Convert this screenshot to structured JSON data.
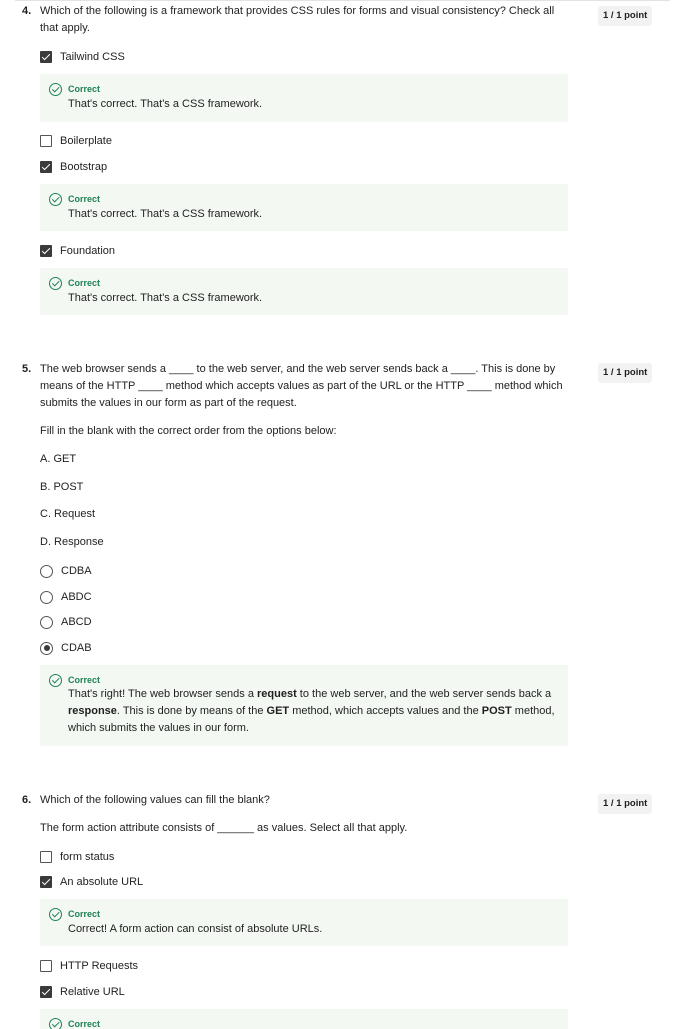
{
  "q4": {
    "number": "4.",
    "text": "Which of the following is a framework that provides CSS rules for forms and visual consistency? Check all that apply.",
    "points": "1 / 1 point",
    "options": [
      {
        "label": "Tailwind CSS",
        "checked": true
      },
      {
        "label": "Boilerplate",
        "checked": false
      },
      {
        "label": "Bootstrap",
        "checked": true
      },
      {
        "label": "Foundation",
        "checked": true
      }
    ],
    "feedback": [
      {
        "title": "Correct",
        "text": "That's correct. That's a CSS framework."
      },
      {
        "title": "Correct",
        "text": "That's correct. That's a CSS framework."
      },
      {
        "title": "Correct",
        "text": "That's correct. That's a CSS framework."
      }
    ]
  },
  "q5": {
    "number": "5.",
    "text": "The web browser sends a ____ to the web server, and the web server sends back a ____. This is done by means of the HTTP ____ method which accepts values as part of the URL or the HTTP ____ method which submits the values in our form as part of the request.",
    "points": "1 / 1 point",
    "instruction": "Fill in the blank with the correct order from the options below:",
    "choices": [
      "A. GET",
      "B. POST",
      "C. Request",
      "D. Response"
    ],
    "options": [
      {
        "label": "CDBA",
        "selected": false
      },
      {
        "label": "ABDC",
        "selected": false
      },
      {
        "label": "ABCD",
        "selected": false
      },
      {
        "label": "CDAB",
        "selected": true
      }
    ],
    "feedback": {
      "title": "Correct",
      "parts": [
        {
          "t": "That's right! The web browser sends a ",
          "b": false
        },
        {
          "t": "request",
          "b": true
        },
        {
          "t": " to the web server, and the web server sends back a ",
          "b": false
        },
        {
          "t": "response",
          "b": true
        },
        {
          "t": ". This is done by means of the ",
          "b": false
        },
        {
          "t": "GET",
          "b": true
        },
        {
          "t": " method, which accepts values and the ",
          "b": false
        },
        {
          "t": "POST",
          "b": true
        },
        {
          "t": " method, which submits the values in our form.",
          "b": false
        }
      ]
    }
  },
  "q6": {
    "number": "6.",
    "text": "Which of the following values can fill the blank?",
    "points": "1 / 1 point",
    "instruction": "The form action attribute consists of ______ as values. Select all that apply.",
    "options": [
      {
        "label": "form status",
        "checked": false
      },
      {
        "label": "An absolute URL",
        "checked": true
      },
      {
        "label": "HTTP Requests",
        "checked": false
      },
      {
        "label": "Relative URL",
        "checked": true
      }
    ],
    "feedback": [
      {
        "title": "Correct",
        "text": "Correct! A form action can consist of absolute URLs."
      },
      {
        "title": "Correct",
        "text": ""
      }
    ]
  },
  "colors": {
    "correct_green": "#1f8354",
    "feedback_bg": "#f3f8f3",
    "points_bg": "#f2f2f2"
  }
}
